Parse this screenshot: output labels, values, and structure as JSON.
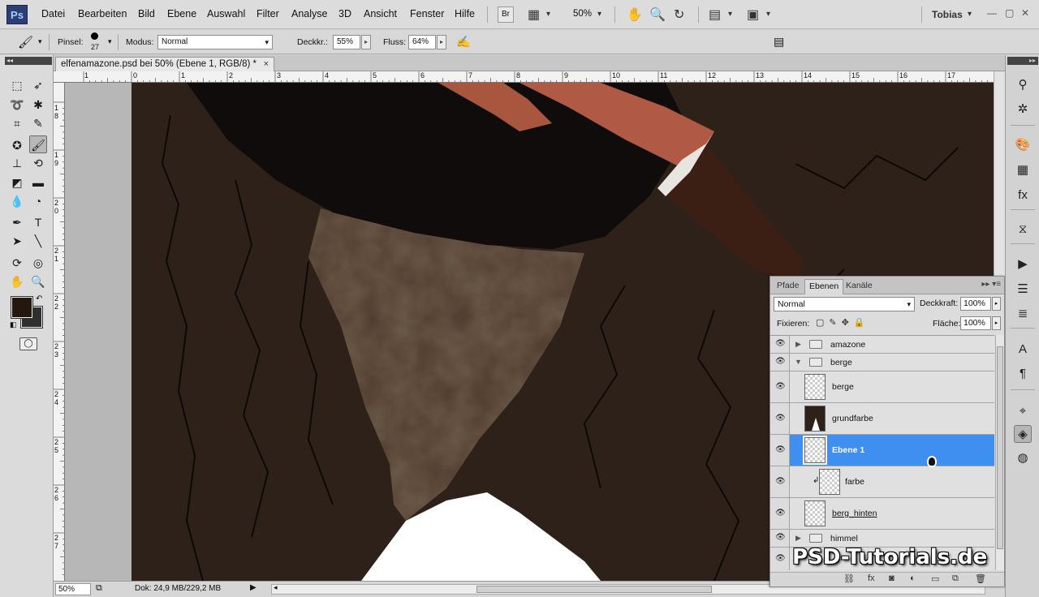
{
  "app": {
    "logo": "Ps",
    "user": "Tobias",
    "zoom_menu": "50%"
  },
  "menu": [
    "Datei",
    "Bearbeiten",
    "Bild",
    "Ebene",
    "Auswahl",
    "Filter",
    "Analyse",
    "3D",
    "Ansicht",
    "Fenster",
    "Hilfe"
  ],
  "menubar_buttons": {
    "bridge": "Br"
  },
  "options": {
    "brush_label": "Pinsel:",
    "brush_size": "27",
    "mode_label": "Modus:",
    "mode_value": "Normal",
    "opacity_label": "Deckkr.:",
    "opacity_value": "55%",
    "flow_label": "Fluss:",
    "flow_value": "64%"
  },
  "document": {
    "tab_title": "elfenamazone.psd bei 50% (Ebene 1, RGB/8) *",
    "close": "×"
  },
  "ruler": {
    "top": [
      "1",
      "0",
      "1",
      "2",
      "3",
      "4",
      "5",
      "6",
      "7",
      "8",
      "9",
      "10",
      "11",
      "12",
      "13",
      "14",
      "15",
      "16",
      "17"
    ],
    "left": [
      "1",
      "8",
      "1",
      "9",
      "2",
      "0",
      "2",
      "1",
      "2",
      "2",
      "2",
      "3",
      "2",
      "4",
      "2",
      "5",
      "2",
      "6",
      "2",
      "7"
    ]
  },
  "status": {
    "zoom": "50%",
    "doc_info": "Dok: 24,9 MB/229,2 MB"
  },
  "layers_panel": {
    "tabs": [
      "Pfade",
      "Ebenen",
      "Kanäle"
    ],
    "active_tab": "Ebenen",
    "blend_mode": "Normal",
    "opacity_label": "Deckkraft:",
    "opacity_value": "100%",
    "lock_label": "Fixieren:",
    "fill_label": "Fläche:",
    "fill_value": "100%",
    "layers": [
      {
        "name": "amazone",
        "kind": "group",
        "expanded": false
      },
      {
        "name": "berge",
        "kind": "group",
        "expanded": true
      },
      {
        "name": "berge",
        "kind": "layer"
      },
      {
        "name": "grundfarbe",
        "kind": "layer"
      },
      {
        "name": "Ebene 1",
        "kind": "layer",
        "selected": true
      },
      {
        "name": "farbe",
        "kind": "clipped-layer"
      },
      {
        "name": "berg_hinten",
        "kind": "layer"
      },
      {
        "name": "himmel",
        "kind": "group",
        "expanded": false
      }
    ]
  },
  "watermark": "PSD-Tutorials.de",
  "colors": {
    "foreground": "#24170f",
    "background": "#2f2f2f",
    "selection": "#3f8ff0"
  }
}
